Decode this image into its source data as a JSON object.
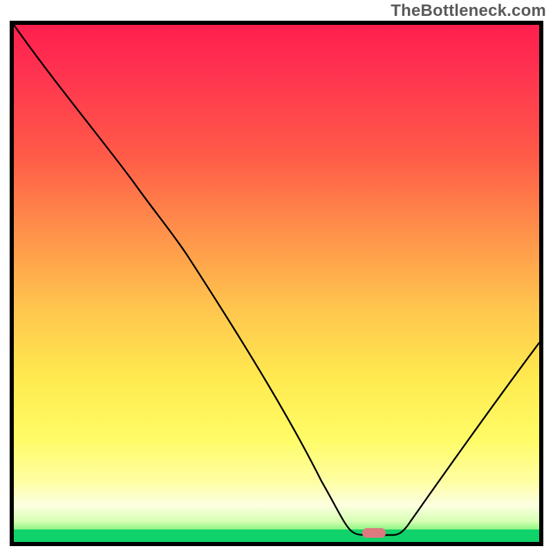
{
  "watermark": "TheBottleneck.com",
  "chart_data": {
    "type": "line",
    "title": "",
    "xlabel": "",
    "ylabel": "",
    "xlim": [
      0,
      100
    ],
    "ylim": [
      0,
      100
    ],
    "x": [
      0,
      5,
      10,
      15,
      20,
      25,
      30,
      35,
      40,
      45,
      50,
      55,
      60,
      63,
      66,
      68,
      70,
      72,
      75,
      80,
      85,
      90,
      95,
      100
    ],
    "values": [
      100,
      92,
      83,
      75,
      70,
      65,
      57,
      48,
      40,
      33,
      25,
      18,
      11,
      6,
      2,
      1,
      1,
      1,
      2,
      7,
      15,
      25,
      35,
      40
    ],
    "optimal_x": 68.5,
    "marker": {
      "x": 68.5,
      "y": 1
    },
    "gradient_stops": [
      {
        "pos": 0,
        "color": "#ff1f4d"
      },
      {
        "pos": 25,
        "color": "#ff5a48"
      },
      {
        "pos": 55,
        "color": "#ffc64e"
      },
      {
        "pos": 80,
        "color": "#fffc66"
      },
      {
        "pos": 96,
        "color": "#d6ffb3"
      },
      {
        "pos": 100,
        "color": "#0fd36a"
      }
    ]
  },
  "colors": {
    "border": "#000000",
    "curve": "#000000",
    "marker": "#dd7a7f",
    "watermark": "#5a5a5a"
  }
}
